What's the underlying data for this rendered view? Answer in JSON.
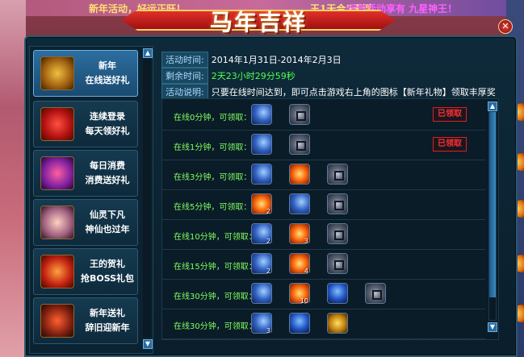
{
  "top_marquee": {
    "text1": "新年活动，好运正旺！",
    "text2": "王1天合5天浮，",
    "text3": "运气活动享有 九星神王！"
  },
  "banner": {
    "title": "马年吉祥"
  },
  "close_label": "✕",
  "tabs": [
    {
      "line1": "新年",
      "line2": "在线送好礼",
      "active": true
    },
    {
      "line1": "连续登录",
      "line2": "每天领好礼"
    },
    {
      "line1": "每日消费",
      "line2": "消费送好礼"
    },
    {
      "line1": "仙灵下凡",
      "line2": "神仙也过年"
    },
    {
      "line1": "王的贺礼",
      "line2": "抢BOSS礼包"
    },
    {
      "line1": "新年送礼",
      "line2": "辞旧迎新年"
    }
  ],
  "info": {
    "time_label": "活动时间:",
    "time_value": "2014年1月31日-2014年2月3日",
    "remain_label": "剩余时间:",
    "remain_value": "2天23小时29分59秒",
    "desc_label": "活动说明:",
    "desc_value": "只要在线时间达到，即可点击游戏右上角的图标【新年礼物】领取丰厚奖励。"
  },
  "rewards": [
    {
      "label": "在线0分钟，可领取：",
      "claimed": "已领取",
      "items": [
        {
          "icon": "moon",
          "qty": ""
        },
        {
          "icon": "coin",
          "qty": ""
        }
      ]
    },
    {
      "label": "在线1分钟，可领取：",
      "claimed": "已领取",
      "items": [
        {
          "icon": "moon",
          "qty": ""
        },
        {
          "icon": "coin",
          "qty": ""
        }
      ]
    },
    {
      "label": "在线3分钟，可领取：",
      "claimed": "",
      "items": [
        {
          "icon": "moon",
          "qty": ""
        },
        {
          "icon": "fire",
          "qty": ""
        },
        {
          "icon": "coin",
          "qty": ""
        }
      ]
    },
    {
      "label": "在线5分钟，可领取：",
      "claimed": "",
      "items": [
        {
          "icon": "fire",
          "qty": "2"
        },
        {
          "icon": "moon",
          "qty": ""
        },
        {
          "icon": "coin",
          "qty": ""
        }
      ]
    },
    {
      "label": "在线10分钟，可领取：",
      "claimed": "",
      "items": [
        {
          "icon": "moon",
          "qty": "2"
        },
        {
          "icon": "fire",
          "qty": "3"
        },
        {
          "icon": "coin",
          "qty": ""
        }
      ]
    },
    {
      "label": "在线15分钟，可领取：",
      "claimed": "",
      "items": [
        {
          "icon": "moon",
          "qty": "2"
        },
        {
          "icon": "fire",
          "qty": "4"
        },
        {
          "icon": "coin",
          "qty": ""
        }
      ]
    },
    {
      "label": "在线30分钟，可领取：",
      "claimed": "",
      "items": [
        {
          "icon": "moon",
          "qty": ""
        },
        {
          "icon": "fire",
          "qty": "10"
        },
        {
          "icon": "gem",
          "qty": ""
        },
        {
          "icon": "coin",
          "qty": ""
        }
      ]
    },
    {
      "label": "在线30分钟，可领取：",
      "claimed": "",
      "items": [
        {
          "icon": "moon",
          "qty": "3"
        },
        {
          "icon": "gem",
          "qty": ""
        },
        {
          "icon": "gold",
          "qty": ""
        }
      ]
    }
  ]
}
